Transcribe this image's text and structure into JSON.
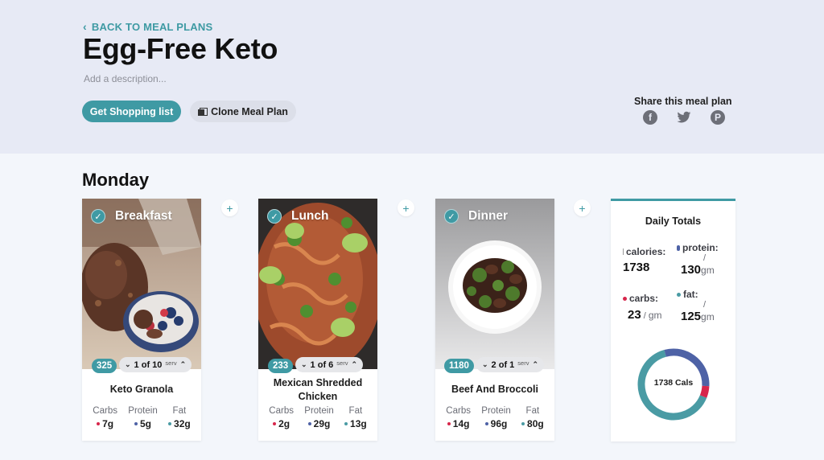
{
  "header": {
    "back_link": "BACK TO MEAL PLANS",
    "title": "Egg-Free Keto",
    "description_placeholder": "Add a description...",
    "shopping_button": "Get Shopping list",
    "clone_button": "Clone Meal Plan",
    "share_label": "Share this meal plan",
    "share_icons": [
      "facebook-icon",
      "twitter-icon",
      "pinterest-icon"
    ]
  },
  "day": {
    "title": "Monday",
    "meals": [
      {
        "meal": "Breakfast",
        "calories": "325",
        "servings": "1 of 10",
        "serv_unit": "serv",
        "recipe": "Keto Granola",
        "macros": [
          {
            "label": "Carbs",
            "value": "7g",
            "color": "#d7264b"
          },
          {
            "label": "Protein",
            "value": "5g",
            "color": "#4e62a6"
          },
          {
            "label": "Fat",
            "value": "32g",
            "color": "#4a9ba4"
          }
        ]
      },
      {
        "meal": "Lunch",
        "calories": "233",
        "servings": "1 of 6",
        "serv_unit": "serv",
        "recipe": "Mexican Shredded Chicken",
        "macros": [
          {
            "label": "Carbs",
            "value": "2g",
            "color": "#d7264b"
          },
          {
            "label": "Protein",
            "value": "29g",
            "color": "#4e62a6"
          },
          {
            "label": "Fat",
            "value": "13g",
            "color": "#4a9ba4"
          }
        ]
      },
      {
        "meal": "Dinner",
        "calories": "1180",
        "servings": "2 of 1",
        "serv_unit": "serv",
        "recipe": "Beef And Broccoli",
        "macros": [
          {
            "label": "Carbs",
            "value": "14g",
            "color": "#d7264b"
          },
          {
            "label": "Protein",
            "value": "96g",
            "color": "#4e62a6"
          },
          {
            "label": "Fat",
            "value": "80g",
            "color": "#4a9ba4"
          }
        ]
      }
    ]
  },
  "totals": {
    "title": "Daily Totals",
    "calories_label": "calories:",
    "calories_value": "1738",
    "protein_label": "protein:",
    "protein_value": "130",
    "protein_unit": "gm",
    "carbs_label": "carbs:",
    "carbs_value": "23",
    "carbs_unit": "gm",
    "fat_label": "fat:",
    "fat_value": "125",
    "fat_unit": "gm",
    "donut_label": "1738 Cals",
    "colors": {
      "carbs": "#d7264b",
      "protein": "#4e62a6",
      "fat": "#4a9ba4"
    }
  },
  "colors": {
    "accent": "#3f9aa4",
    "header_bg": "#e7eaf5",
    "page_bg": "#f3f6fb"
  }
}
